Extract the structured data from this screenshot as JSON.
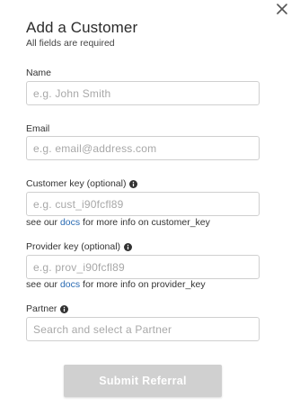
{
  "dialog": {
    "title": "Add a Customer",
    "subtitle": "All fields are required",
    "close_icon": "close-icon"
  },
  "fields": {
    "name": {
      "label": "Name",
      "placeholder": "e.g. John Smith",
      "value": ""
    },
    "email": {
      "label": "Email",
      "placeholder": "e.g. email@address.com",
      "value": ""
    },
    "customer_key": {
      "label": "Customer key (optional)",
      "placeholder": "e.g. cust_i90fcfl89",
      "value": "",
      "help_prefix": "see our ",
      "help_link": "docs",
      "help_suffix": " for more info on customer_key"
    },
    "provider_key": {
      "label": "Provider key (optional)",
      "placeholder": "e.g. prov_i90fcfl89",
      "value": "",
      "help_prefix": "see our ",
      "help_link": "docs",
      "help_suffix": " for more info on provider_key"
    },
    "partner": {
      "label": "Partner",
      "placeholder": "Search and select a Partner",
      "value": ""
    }
  },
  "actions": {
    "submit_label": "Submit Referral"
  },
  "colors": {
    "link": "#2a6bb3",
    "submit_disabled_bg": "#d0d0d0",
    "input_border": "#cfcfcf",
    "placeholder": "#a8a8a8"
  }
}
